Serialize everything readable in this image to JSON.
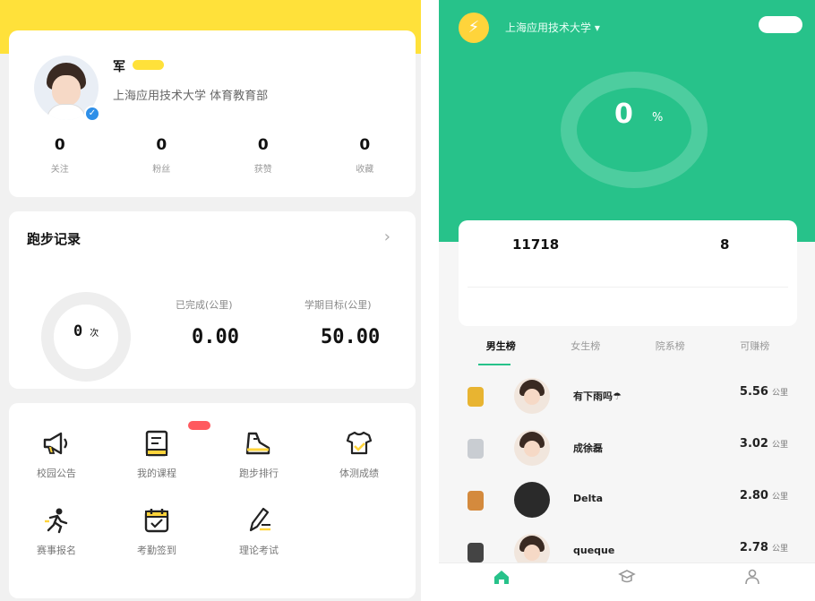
{
  "colors": {
    "left_accent_yellow": "#ffe13a",
    "right_accent_green": "#27c28a",
    "new_tag_red": "#ff5a5f"
  },
  "left_screen": {
    "profile": {
      "name": "军",
      "organization": "上海应用技术大学 体育教育部",
      "stats": [
        {
          "value": "0",
          "label": "关注"
        },
        {
          "value": "0",
          "label": "粉丝"
        },
        {
          "value": "0",
          "label": "获赞"
        },
        {
          "value": "0",
          "label": "收藏"
        }
      ]
    },
    "run_record": {
      "title": "跑步记录",
      "ring_value": "0",
      "ring_unit": "次",
      "completed_label": "已完成(公里)",
      "completed_value": "0.00",
      "goal_label": "学期目标(公里)",
      "goal_value": "50.00"
    },
    "features": [
      {
        "label": "校园公告",
        "icon": "megaphone-icon"
      },
      {
        "label": "我的课程",
        "icon": "course-book-icon"
      },
      {
        "label": "跑步排行",
        "icon": "shoe-icon"
      },
      {
        "label": "体测成绩",
        "icon": "fitness-shirt-icon"
      },
      {
        "label": "赛事报名",
        "icon": "runner-icon"
      },
      {
        "label": "考勤签到",
        "icon": "calendar-check-icon"
      },
      {
        "label": "理论考试",
        "icon": "exam-pen-icon"
      }
    ]
  },
  "right_screen": {
    "header": {
      "school": "上海应用技术大学 ▾"
    },
    "progress": {
      "percent": "0",
      "unit": "%"
    },
    "summary": [
      {
        "value": "11718"
      },
      {
        "value": "8"
      }
    ],
    "tabs": [
      "男生榜",
      "女生榜",
      "院系榜",
      "可赚榜"
    ],
    "rankings": [
      {
        "name": "有下雨吗☂",
        "distance": "5.56",
        "unit": "公里",
        "medal_color": "#e8b431"
      },
      {
        "name": "成徐磊",
        "distance": "3.02",
        "unit": "公里",
        "medal_color": "#c9cdd2"
      },
      {
        "name": "Delta",
        "distance": "2.80",
        "unit": "公里",
        "medal_color": "#d48a3d"
      },
      {
        "name": "queque",
        "distance": "2.78",
        "unit": "公里",
        "medal_color": "#444444"
      }
    ],
    "bottom_nav": [
      {
        "icon": "home-icon",
        "active": true
      },
      {
        "icon": "graduation-cap-icon",
        "active": false
      },
      {
        "icon": "person-icon",
        "active": false
      }
    ]
  }
}
